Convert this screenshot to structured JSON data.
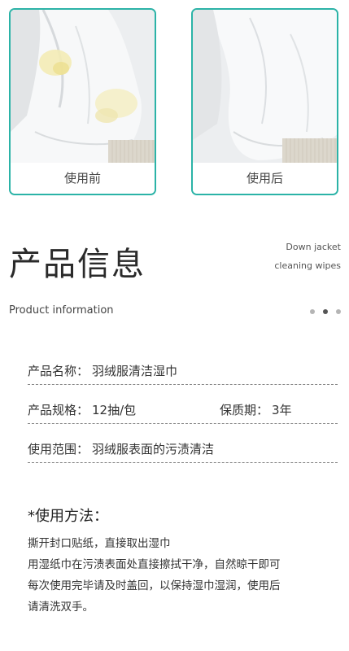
{
  "comparison": {
    "before_label": "使用前",
    "after_label": "使用后"
  },
  "heading": {
    "title_cn": "产品信息",
    "subtitle_en_line1": "Down jacket",
    "subtitle_en_line2": "cleaning wipes",
    "section_en": "Product information"
  },
  "carousel": {
    "dot_count": 3,
    "active_index": 1
  },
  "info": {
    "name_label": "产品名称：",
    "name_value": "羽绒服清洁湿巾",
    "spec_label": "产品规格：",
    "spec_value": "12抽/包",
    "shelf_label": "保质期：",
    "shelf_value": "3年",
    "scope_label": "使用范围：",
    "scope_value": "羽绒服表面的污渍清洁"
  },
  "method": {
    "title": "*使用方法：",
    "lines": [
      "撕开封口贴纸，直接取出湿巾",
      "用湿纸巾在污渍表面处直接擦拭干净，自然晾干即可",
      "每次使用完毕请及时盖回，以保持湿巾湿润，使用后",
      "请清洗双手。"
    ]
  },
  "colors": {
    "card_border": "#2bb3a7",
    "stain": "#f0e6a8",
    "dot_active": "#555555",
    "dot_inactive": "#b5b5b5"
  }
}
